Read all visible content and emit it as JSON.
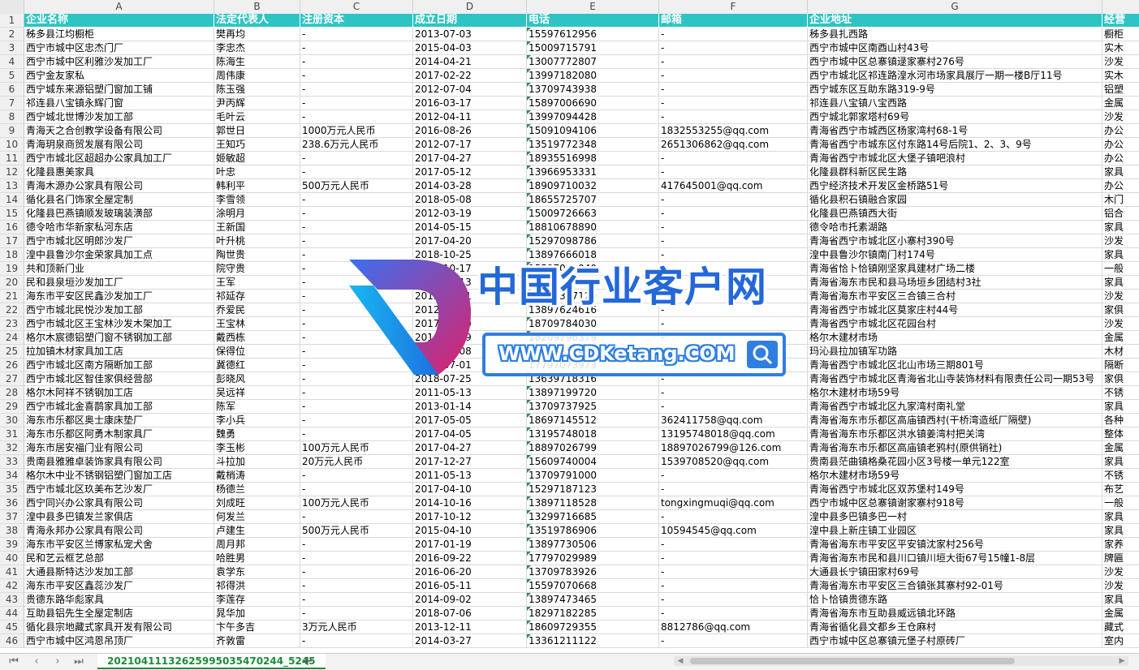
{
  "columns": [
    "A",
    "B",
    "C",
    "D",
    "E",
    "F",
    "G"
  ],
  "headers": [
    "企业名称",
    "法定代表人",
    "注册资本",
    "成立日期",
    "电话",
    "邮箱",
    "企业地址",
    "经营"
  ],
  "rows": [
    {
      "n": "2",
      "c": [
        "秭多县江均橱柜",
        "樊再均",
        "-",
        "2013-07-03",
        "15597612956",
        "-",
        "秭多县扎西路",
        "橱柜"
      ]
    },
    {
      "n": "3",
      "c": [
        "西宁市城中区忠杰门厂",
        "李忠杰",
        "-",
        "2015-04-03",
        "15009715791",
        "-",
        "西宁市城中区南酉山村43号",
        "实木"
      ]
    },
    {
      "n": "4",
      "c": [
        "西宁市城中区利雅沙发加工厂",
        "陈海生",
        "-",
        "2014-04-21",
        "13007772807",
        "-",
        "西宁市城中区总寨镇逯家寨村276号",
        "沙发"
      ]
    },
    {
      "n": "5",
      "c": [
        "西宁金友家私",
        "周伟康",
        "-",
        "2017-02-22",
        "13997182080",
        "-",
        "西宁市城北区祁连路湟水河市场家具展厅一期一楼B厅11号",
        "实木"
      ]
    },
    {
      "n": "6",
      "c": [
        "西宁城东来源铝塑门窗加工铺",
        "陈玉强",
        "-",
        "2012-07-04",
        "13709743938",
        "-",
        "西宁城东区互助东路319-9号",
        "铝塑"
      ]
    },
    {
      "n": "7",
      "c": [
        "祁连县八宝镇永辉门窗",
        "尹丙辉",
        "-",
        "2016-03-17",
        "15897006690",
        "-",
        "祁连县八宝镇八宝西路",
        "金属"
      ]
    },
    {
      "n": "8",
      "c": [
        "西宁城北世博沙发加工部",
        "毛叶云",
        "-",
        "2012-04-11",
        "13997094428",
        "-",
        "西宁城北郭家塔村69号",
        "沙发"
      ]
    },
    {
      "n": "9",
      "c": [
        "青海天之合创教学设备有限公司",
        "郭世日",
        "1000万元人民币",
        "2016-08-26",
        "15091094106",
        "1832553255@qq.com",
        "青海省西宁市城西区杨家湾村68-1号",
        "办公"
      ]
    },
    {
      "n": "10",
      "c": [
        "青海玥泉商贸发展有限公司",
        "王知巧",
        "238.6万元人民币",
        "2012-07-17",
        "13519772348",
        "2651306862@qq.com",
        "青海省西宁市城东区付东路14号后院1、2、3、9号",
        "办公"
      ]
    },
    {
      "n": "11",
      "c": [
        "西宁市城北区超超办公家具加工厂",
        "姬敏超",
        "-",
        "2017-04-27",
        "18935516998",
        "-",
        "青海省西宁市城北区大堡子镇吧浪村",
        "办公"
      ]
    },
    {
      "n": "12",
      "c": [
        "化隆县惠美家具",
        "叶忠",
        "-",
        "2017-05-12",
        "13966953331",
        "-",
        "化隆县群科新区民生路",
        "家具"
      ]
    },
    {
      "n": "13",
      "c": [
        "青海木源办公家具有限公司",
        "韩利平",
        "500万元人民币",
        "2014-03-28",
        "18909710032",
        "417645001@qq.com",
        "西宁经济技术开发区金桥路51号",
        "办公"
      ]
    },
    {
      "n": "14",
      "c": [
        "循化县名门饰家全屋定制",
        "李雪领",
        "-",
        "2018-05-08",
        "18655725707",
        "-",
        "循化县积石镇融合家园",
        "木门"
      ]
    },
    {
      "n": "15",
      "c": [
        "化隆县巴燕镇顺发玻璃装潢部",
        "涂明月",
        "-",
        "2012-03-19",
        "15009726663",
        "-",
        "化隆县巴燕镇西大街",
        "铝合"
      ]
    },
    {
      "n": "16",
      "c": [
        "德令哈市华新家私河东店",
        "王新国",
        "-",
        "2014-05-15",
        "18810678890",
        "-",
        "德令哈市托素湖路",
        "家具"
      ]
    },
    {
      "n": "17",
      "c": [
        "西宁市城北区明郎沙发厂",
        "叶升桃",
        "-",
        "2017-04-20",
        "15297098786",
        "-",
        "青海省西宁市城北区小寨村390号",
        "沙发"
      ]
    },
    {
      "n": "18",
      "c": [
        "湟中县鲁沙尔金荣家具加工点",
        "陶世贵",
        "-",
        "2018-10-25",
        "13897666018",
        "-",
        "湟中县鲁沙尔镇南门村174号",
        "家具"
      ]
    },
    {
      "n": "19",
      "c": [
        "共和顶新门业",
        "院守贵",
        "-",
        "2014-10-17",
        "15597099040",
        "-",
        "青海省恰卜恰镇刚坚家具建材广场二楼",
        "一般"
      ]
    },
    {
      "n": "20",
      "c": [
        "民和县泉垣沙发加工厂",
        "王军",
        "-",
        "2016-06-13",
        "18997209866",
        "-",
        "青海省海东市民和县马场垣乡团结村3社",
        "家具"
      ]
    },
    {
      "n": "21",
      "c": [
        "海东市平安区民鑫沙发加工厂",
        "祁延存",
        "-",
        "2015-04-01",
        "13997387120",
        "-",
        "青海省海东市平安区三合镇三合村",
        "沙发"
      ]
    },
    {
      "n": "22",
      "c": [
        "西宁市城北民悦沙发加工部",
        "乔爱民",
        "-",
        "2012-06-19",
        "13897624616",
        "-",
        "青海省西宁市城北区莫家庄村44号",
        "家俱"
      ]
    },
    {
      "n": "23",
      "c": [
        "西宁市城北区王宝林沙发木架加工",
        "王宝林",
        "-",
        "2017-03-10",
        "18709784030",
        "-",
        "青海省西宁市城北区花园台村",
        "沙发"
      ]
    },
    {
      "n": "24",
      "c": [
        "格尔木宸德铝塑门窗不锈钢加工部",
        "戴西栋",
        "-",
        "2016-08-09",
        "18209796379",
        "-",
        "格尔木建材市场",
        "金属"
      ]
    },
    {
      "n": "25",
      "c": [
        "拉加镇木材家具加工店",
        "保得位",
        "-",
        "2014-03-08",
        "18997552466",
        "-",
        "玛沁县拉加镇军功路",
        "木材"
      ]
    },
    {
      "n": "26",
      "c": [
        "西宁市城北区南方隔断加工部",
        "冀德红",
        "-",
        "2017-07-01",
        "17797073973",
        "-",
        "青海省西宁市城北区北山市场三期801号",
        "隔断"
      ]
    },
    {
      "n": "27",
      "c": [
        "西宁市城北区智佳家俱经营部",
        "彭晓风",
        "-",
        "2018-07-25",
        "13639718316",
        "-",
        "青海省西宁市城北区青海省北山寺装饰材料有限责任公司一期53号",
        "家俱"
      ]
    },
    {
      "n": "28",
      "c": [
        "格尔木阿祥不锈钢加工店",
        "吴远祥",
        "-",
        "2011-05-13",
        "13897199720",
        "-",
        "格尔木建材市场59号",
        "不锈"
      ]
    },
    {
      "n": "29",
      "c": [
        "西宁市城北金喜鹊家具加工部",
        "陈军",
        "-",
        "2013-01-14",
        "13709737925",
        "-",
        "青海省西宁市城北区九家湾村南礼堂",
        "家具"
      ]
    },
    {
      "n": "30",
      "c": [
        "海东市乐都区奥士康床垫厂",
        "李小兵",
        "-",
        "2017-05-05",
        "18697145512",
        "362411758@qq.com",
        "青海省海东市乐都区高庙镇西村(干桥湾造纸厂隔壁)",
        "各种"
      ]
    },
    {
      "n": "31",
      "c": [
        "海东市乐都区阿勇木制家具厂",
        "魏勇",
        "-",
        "2017-04-05",
        "13195748018",
        "13195748018@qq.com",
        "青海省海东市乐都区洪水镇姜湾村把关湾",
        "整体"
      ]
    },
    {
      "n": "32",
      "c": [
        "海东市居安福门业有限公司",
        "李玉彬",
        "100万元人民币",
        "2017-04-27",
        "18897026799",
        "18897026799@126.com",
        "青海省海东市乐都区高庙镇老鸦村(原供销社)",
        "金属"
      ]
    },
    {
      "n": "33",
      "c": [
        "贵南县雅雅卓装饰家具有限公司",
        "斗拉加",
        "20万元人民币",
        "2017-12-27",
        "15609740004",
        "1539708520@qq.com",
        "贵南县茫曲镇格桑花园小区3号楼一单元122室",
        "家具"
      ]
    },
    {
      "n": "34",
      "c": [
        "格尔木中业不锈钢铝塑门窗加工店",
        "戴梢涛",
        "-",
        "2011-05-13",
        "13709791000",
        "-",
        "格尔木建材市场59号",
        "不锈"
      ]
    },
    {
      "n": "35",
      "c": [
        "西宁市城北区玖美布艺沙发厂",
        "杨德兰",
        "-",
        "2017-04-10",
        "15297187123",
        "-",
        "青海省西宁市城北区双苏堡村149号",
        "布艺"
      ]
    },
    {
      "n": "36",
      "c": [
        "西宁同兴办公家具有限公司",
        "刘成旺",
        "100万元人民币",
        "2014-10-16",
        "13897118528",
        "tongxingmuqi@qq.com",
        "西宁市城中区总寨镇谢家寨村918号",
        "一般"
      ]
    },
    {
      "n": "37",
      "c": [
        "湟中县多巴镇发兰家俱店",
        "何发兰",
        "-",
        "2017-10-12",
        "13299716685",
        "-",
        "湟中县多巴镇多巴一村",
        "家具"
      ]
    },
    {
      "n": "38",
      "c": [
        "青海永邦办公家具有限公司",
        "卢建生",
        "500万元人民币",
        "2015-04-10",
        "13519786906",
        "10594545@qq.com",
        "湟中县上新庄镇工业园区",
        "家具"
      ]
    },
    {
      "n": "39",
      "c": [
        "海东市平安区兰博家私宠犬舍",
        "周月邦",
        "-",
        "2017-01-19",
        "13897730506",
        "-",
        "青海省海东市平安区平安镇沈家村256号",
        "家养"
      ]
    },
    {
      "n": "40",
      "c": [
        "民和艺云框艺总部",
        "哈胜男",
        "-",
        "2016-09-22",
        "17797029989",
        "-",
        "青海省海东市民和县川口镇川垣大街67号15幢1-8层",
        "牌匾"
      ]
    },
    {
      "n": "41",
      "c": [
        "大通县斯特达沙发加工部",
        "袁学东",
        "-",
        "2016-06-20",
        "13709783926",
        "-",
        "大通县长宁镇田家村69号",
        "沙发"
      ]
    },
    {
      "n": "42",
      "c": [
        "海东市平安区鑫蕊沙发厂",
        "祁得洪",
        "-",
        "2016-05-11",
        "15597070668",
        "-",
        "青海省海东市平安区三合镇张其寨村92-01号",
        "沙发"
      ]
    },
    {
      "n": "43",
      "c": [
        "贵德东路华彪家具",
        "李莲存",
        "-",
        "2014-09-02",
        "13897473465",
        "-",
        "恰卜恰镇贵德东路",
        "家具"
      ]
    },
    {
      "n": "44",
      "c": [
        "互助县铝先生全屋定制店",
        "晁华加",
        "-",
        "2018-07-06",
        "18297182285",
        "-",
        "青海省海东市互助县威远镇北环路",
        "金属"
      ]
    },
    {
      "n": "45",
      "c": [
        "循化县宗地藏式家具开发有限公司",
        "卞午多吉",
        "3万元人民币",
        "2013-12-11",
        "18609729355",
        "8812786@qq.com",
        "青海省循化县文都乡王仓麻村",
        "藏式"
      ]
    },
    {
      "n": "46",
      "c": [
        "西宁市城中区鸿恩吊顶厂",
        "齐敦雷",
        "-",
        "2014-03-27",
        "13361211122",
        "-",
        "西宁市城中区总寨镇元堡子村原砖厂",
        "室内"
      ]
    }
  ],
  "sheet_tab": "20210411132625995035470244_5245",
  "watermark": {
    "title": "中国行业客户网",
    "url": "WWW.CDKetang.COM"
  },
  "colors": {
    "header_bg": "#2fc4c4",
    "sheet_tab": "#1e8a3a",
    "watermark": "#2468d8"
  }
}
